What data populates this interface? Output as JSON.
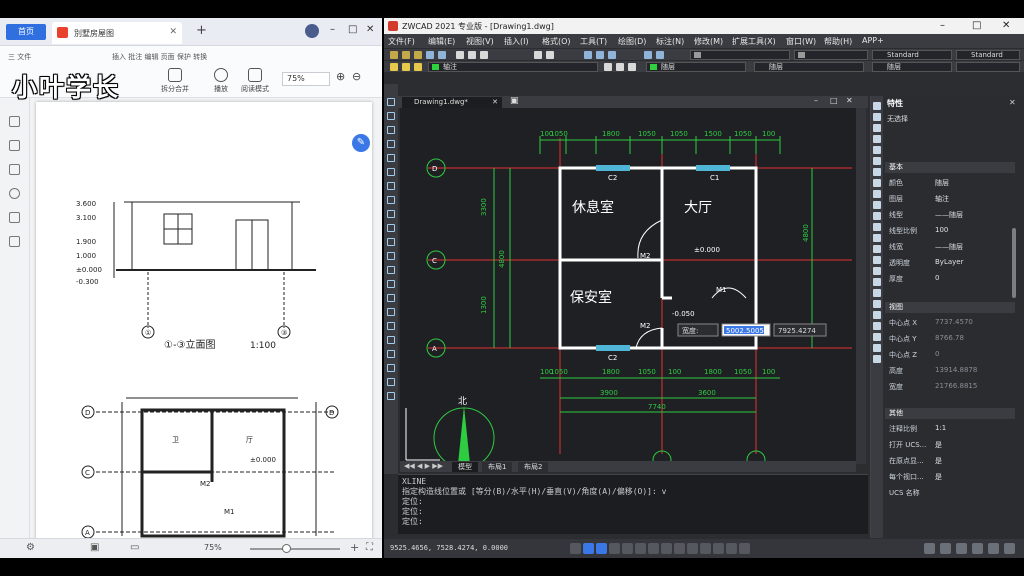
{
  "watermark": "小叶学长",
  "pdf": {
    "home_tab": "首页",
    "doc_tab": "別墅房屋图",
    "menu": [
      "三 文件",
      "插入 批注 编辑 页面 保护 转换"
    ],
    "ribbon_buttons": [
      "拆分合并",
      "播放",
      "阅读模式"
    ],
    "zoom": "75%",
    "status_zoom": "75%",
    "page": {
      "elevation_title": "①-③立面图",
      "elevation_scale": "1:100",
      "levels": [
        "3.600",
        "3.100",
        "1.900",
        "1.000",
        "±0.000",
        "-0.300"
      ],
      "axes": [
        "①",
        "③"
      ],
      "plan_labels": [
        "D",
        "C",
        "A",
        "B"
      ],
      "plan_rooms": [
        "卫",
        "厅",
        "±0.000"
      ],
      "door_tags": [
        "M2",
        "M1"
      ]
    }
  },
  "cad": {
    "title": "ZWCAD 2021 专业版 - [Drawing1.dwg]",
    "menu": [
      "文件(F)",
      "编辑(E)",
      "视图(V)",
      "插入(I)",
      "格式(O)",
      "工具(T)",
      "绘图(D)",
      "标注(N)",
      "修改(M)",
      "扩展工具(X)",
      "窗口(W)",
      "帮助(H)",
      "APP+"
    ],
    "layer_combo": "轴注",
    "color_combo": "随层",
    "linetype_combo": "随层",
    "lineweight_combo": "随层",
    "style_combo_1": "Standard",
    "style_combo_2": "Standard",
    "doc_tab": "Drawing1.dwg*",
    "layout_tabs": [
      "模型",
      "布局1",
      "布局2"
    ],
    "command_lines": [
      "XLINE",
      "指定构造线位置或 [等分(B)/水平(H)/垂直(V)/角度(A)/偏移(O)]: v",
      "定位:",
      "定位:",
      "定位:"
    ],
    "coords": "9525.4656, 7528.4274, 0.0000",
    "drawing": {
      "rooms": [
        "休息室",
        "大厅",
        "保安室"
      ],
      "axis_bubbles_left": [
        "D",
        "C",
        "A"
      ],
      "dims_top_row": [
        "100",
        "1050",
        "1800",
        "1050",
        "1050",
        "1500",
        "1050",
        "100"
      ],
      "dims_bottom_row": [
        "100",
        "1050",
        "1800",
        "1050",
        "100",
        "1800",
        "1050",
        "100"
      ],
      "dims_total_row": [
        "3900",
        "3600"
      ],
      "dim_total": "7740",
      "dims_left": [
        "3300",
        "1300",
        "4800"
      ],
      "dim_right": "4800",
      "window_tags": [
        "C2",
        "C1",
        "C2"
      ],
      "door_tags": [
        "M2",
        "M1",
        "M2"
      ],
      "levels": [
        "±0.000",
        "-0.050"
      ],
      "north": "北",
      "prompt_label": "宽度:",
      "prompt_value_1": "5002.5005",
      "prompt_value_2": "7925.4274"
    },
    "properties": {
      "title": "特性",
      "selection": "无选择",
      "groups": [
        "基本",
        "视图",
        "其他"
      ],
      "basic": [
        {
          "k": "颜色",
          "v": "随层"
        },
        {
          "k": "图层",
          "v": "轴注"
        },
        {
          "k": "线型",
          "v": "——随层"
        },
        {
          "k": "线型比例",
          "v": "100"
        },
        {
          "k": "线宽",
          "v": "——随层"
        },
        {
          "k": "透明度",
          "v": "ByLayer"
        },
        {
          "k": "厚度",
          "v": "0"
        }
      ],
      "view": [
        {
          "k": "中心点 X",
          "v": "7737.4570"
        },
        {
          "k": "中心点 Y",
          "v": "8766.78"
        },
        {
          "k": "中心点 Z",
          "v": "0"
        },
        {
          "k": "高度",
          "v": "13914.8878"
        },
        {
          "k": "宽度",
          "v": "21766.8815"
        }
      ],
      "other": [
        {
          "k": "注释比例",
          "v": "1:1"
        },
        {
          "k": "打开 UCS...",
          "v": "是"
        },
        {
          "k": "在原点显...",
          "v": "是"
        },
        {
          "k": "每个视口...",
          "v": "是"
        },
        {
          "k": "UCS 名称",
          "v": ""
        }
      ]
    }
  },
  "colors": {
    "cad_bg": "#1f2024",
    "wall": "#ffffff",
    "axis": "#e03030",
    "dim": "#2ecc40",
    "window": "#4fb6d8"
  }
}
